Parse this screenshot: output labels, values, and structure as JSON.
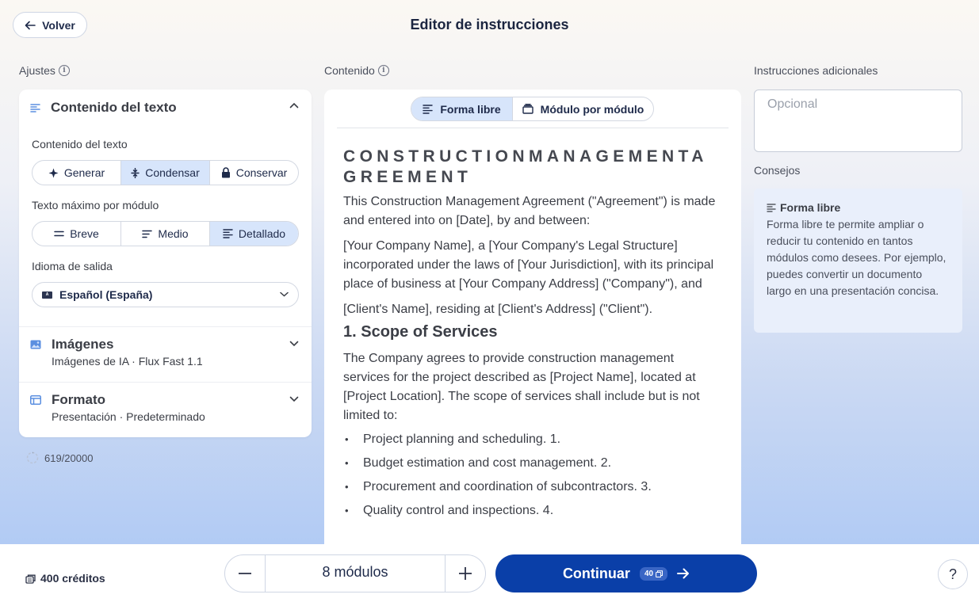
{
  "header": {
    "back_label": "Volver",
    "title": "Editor de instrucciones"
  },
  "settings": {
    "section_label": "Ajustes",
    "text_content": {
      "title": "Contenido del texto",
      "field_label": "Contenido del texto",
      "options": [
        "Generar",
        "Condensar",
        "Conservar"
      ],
      "selected": "Condensar"
    },
    "max_text": {
      "label": "Texto máximo por módulo",
      "options": [
        "Breve",
        "Medio",
        "Detallado"
      ],
      "selected": "Detallado"
    },
    "language": {
      "label": "Idioma de salida",
      "value": "Español (España)"
    },
    "images": {
      "title": "Imágenes",
      "desc": "Imágenes de IA · Flux Fast 1.1"
    },
    "format": {
      "title": "Formato",
      "desc": "Presentación · Predeterminado"
    },
    "counter": "619/20000"
  },
  "content": {
    "section_label": "Contenido",
    "modes": [
      "Forma libre",
      "Módulo por módulo"
    ],
    "selected_mode": "Forma libre",
    "doc": {
      "heading": "CONSTRUCTIONMANAGEMENTAGREEMENT",
      "p1": "This Construction Management Agreement (\"Agreement\") is made and entered into on [Date], by and between:",
      "p2": "[Your Company Name], a [Your Company's Legal Structure] incorporated under the laws of [Your Jurisdiction], with its principal place of business at [Your Company Address] (\"Company\"), and",
      "p3": "[Client's Name], residing at [Client's Address] (\"Client\").",
      "h2": "1. Scope of Services",
      "p4": "The Company agrees to provide construction management services for the project described as [Project Name], located at [Project Location]. The scope of services shall include but is not limited to:",
      "bullets": [
        "Project planning and scheduling. 1.",
        "Budget estimation and cost management. 2.",
        "Procurement and coordination of subcontractors. 3.",
        "Quality control and inspections. 4."
      ]
    }
  },
  "extra": {
    "label": "Instrucciones adicionales",
    "placeholder": "Opcional",
    "tips_label": "Consejos",
    "tip_title": "Forma libre",
    "tip_body": "Forma libre te permite ampliar o reducir tu contenido en tantos módulos como desees. Por ejemplo, puedes convertir un documento largo en una presentación concisa."
  },
  "footer": {
    "credits": "400 créditos",
    "modules": "8 módulos",
    "continue_label": "Continuar",
    "cost": "40",
    "help": "?"
  },
  "colors": {
    "primary": "#0a3fa8",
    "selected_bg": "#d7e5fb",
    "tip_bg": "#e9effb"
  }
}
